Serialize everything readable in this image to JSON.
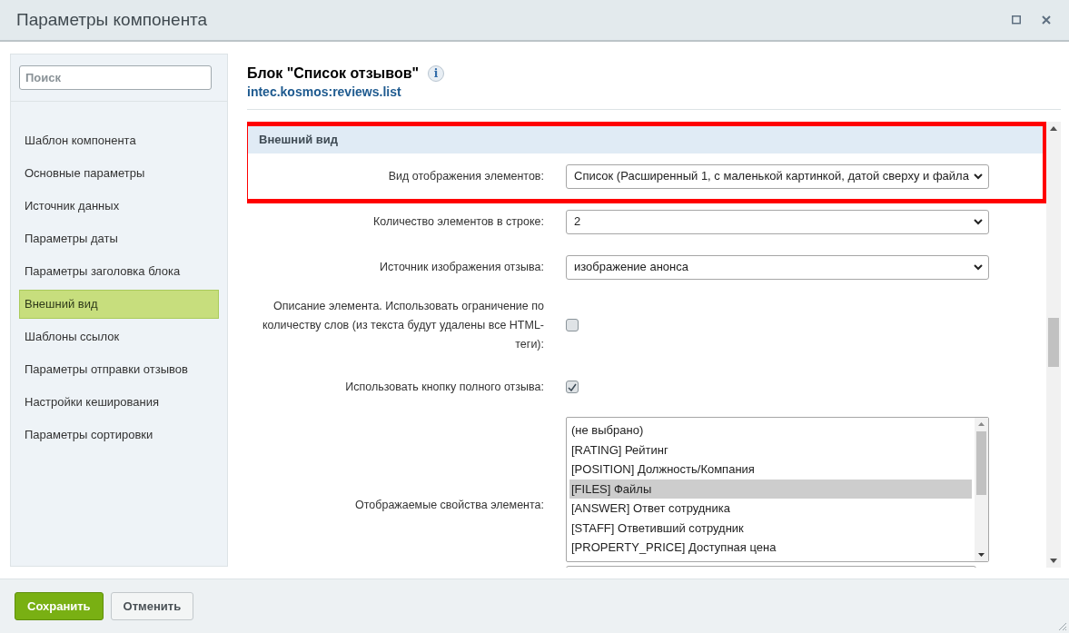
{
  "window": {
    "title": "Параметры компонента"
  },
  "sidebar": {
    "search": {
      "placeholder": "Поиск"
    },
    "items": [
      {
        "label": "Шаблон компонента",
        "selected": false
      },
      {
        "label": "Основные параметры",
        "selected": false
      },
      {
        "label": "Источник данных",
        "selected": false
      },
      {
        "label": "Параметры даты",
        "selected": false
      },
      {
        "label": "Параметры заголовка блока",
        "selected": false
      },
      {
        "label": "Внешний вид",
        "selected": true
      },
      {
        "label": "Шаблоны ссылок",
        "selected": false
      },
      {
        "label": "Параметры отправки отзывов",
        "selected": false
      },
      {
        "label": "Настройки кеширования",
        "selected": false
      },
      {
        "label": "Параметры сортировки",
        "selected": false
      }
    ]
  },
  "component": {
    "title": "Блок \"Список отзывов\"",
    "info": "i",
    "code": "intec.kosmos:reviews.list"
  },
  "section": {
    "title": "Внешний вид",
    "highlighted": true
  },
  "settings": [
    {
      "kind": "select",
      "label": "Вид отображения элементов:",
      "value": "Список (Расширенный 1, с маленькой картинкой, датой сверху и файла"
    },
    {
      "kind": "select",
      "label": "Количество элементов в строке:",
      "value": "2"
    },
    {
      "kind": "select",
      "label": "Источник изображения отзыва:",
      "value": "изображение анонса"
    },
    {
      "kind": "checkbox",
      "label": "Описание элемента. Использовать ограничение по количеству слов (из текста будут удалены все HTML-теги):",
      "checked": false
    },
    {
      "kind": "checkbox",
      "label": "Использовать кнопку полного отзыва:",
      "checked": true
    },
    {
      "kind": "multiselect",
      "label": "Отображаемые свойства элемента:",
      "options": [
        {
          "label": "(не выбрано)",
          "selected": false
        },
        {
          "label": "[RATING] Рейтинг",
          "selected": false
        },
        {
          "label": "[POSITION] Должность/Компания",
          "selected": false
        },
        {
          "label": "[FILES] Файлы",
          "selected": true
        },
        {
          "label": "[ANSWER] Ответ сотрудника",
          "selected": false
        },
        {
          "label": "[STAFF] Ответивший сотрудник",
          "selected": false
        },
        {
          "label": "[PROPERTY_PRICE] Доступная цена",
          "selected": false
        }
      ]
    }
  ],
  "buttons": [
    {
      "kind": "primary",
      "label": "Сохранить"
    },
    {
      "kind": "secondary",
      "label": "Отменить"
    }
  ]
}
